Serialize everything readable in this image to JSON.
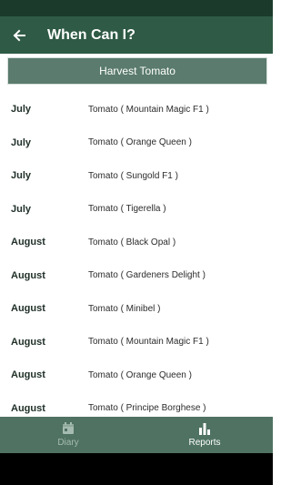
{
  "header": {
    "title": "When Can I?",
    "back_icon": "arrow-left-icon"
  },
  "section": {
    "label": "Harvest Tomato"
  },
  "rows": [
    {
      "month": "July",
      "plant": "Tomato ( Mountain Magic F1 )"
    },
    {
      "month": "July",
      "plant": "Tomato ( Orange Queen )"
    },
    {
      "month": "July",
      "plant": "Tomato ( Sungold F1 )"
    },
    {
      "month": "July",
      "plant": "Tomato ( Tigerella )"
    },
    {
      "month": "August",
      "plant": "Tomato ( Black Opal )"
    },
    {
      "month": "August",
      "plant": "Tomato ( Gardeners Delight )"
    },
    {
      "month": "August",
      "plant": "Tomato ( Minibel )"
    },
    {
      "month": "August",
      "plant": "Tomato ( Mountain Magic F1 )"
    },
    {
      "month": "August",
      "plant": "Tomato ( Orange Queen )"
    },
    {
      "month": "August",
      "plant": "Tomato ( Principe Borghese )"
    }
  ],
  "tabs": [
    {
      "label": "Diary",
      "icon": "calendar-icon",
      "active": false
    },
    {
      "label": "Reports",
      "icon": "bar-chart-icon",
      "active": true
    }
  ],
  "colors": {
    "appbar": "#2f5a45",
    "section_button": "#5a7b6d",
    "tabbar": "#4f7262",
    "active_tab": "#ffffff",
    "inactive_tab": "#a6bbb1"
  }
}
